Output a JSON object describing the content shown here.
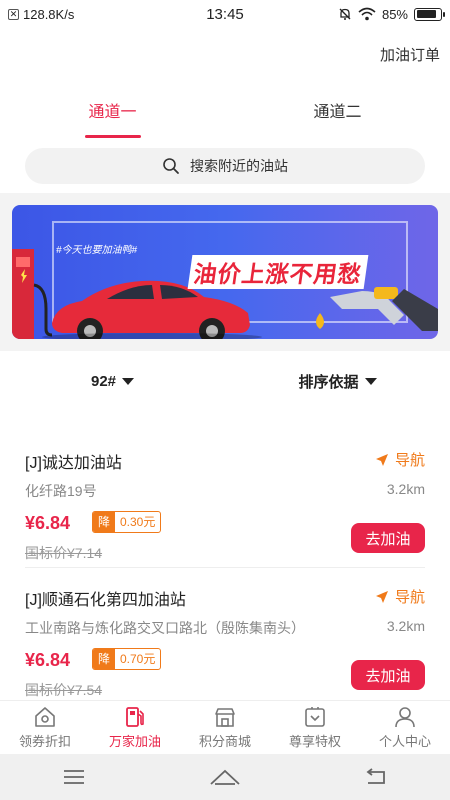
{
  "status": {
    "speed": "128.8K/s",
    "time": "13:45",
    "battery": "85%",
    "battery_level": 0.85
  },
  "header": {
    "order_link": "加油订单"
  },
  "tabs": [
    {
      "label": "通道一",
      "active": true
    },
    {
      "label": "通道二",
      "active": false
    }
  ],
  "search": {
    "placeholder": "搜索附近的油站"
  },
  "banner": {
    "tag": "#今天也要加油鸭#",
    "title": "油价上涨不用愁"
  },
  "filters": {
    "fuel": "92#",
    "sort": "排序依据"
  },
  "stations": [
    {
      "name": "[J]诚达加油站",
      "nav": "导航",
      "address": "化纤路19号",
      "distance": "3.2km",
      "price": "¥6.84",
      "discount_label": "降",
      "discount": "0.30元",
      "standard_price": "国标价¥7.14",
      "button": "去加油"
    },
    {
      "name": "[J]顺通石化第四加油站",
      "nav": "导航",
      "address": "工业南路与炼化路交叉口路北（殷陈集南头）",
      "distance": "3.2km",
      "price": "¥6.84",
      "discount_label": "降",
      "discount": "0.70元",
      "standard_price": "国标价¥7.54",
      "button": "去加油"
    }
  ],
  "tabbar": [
    {
      "label": "领券折扣",
      "icon": "home-coupon-icon",
      "active": false
    },
    {
      "label": "万家加油",
      "icon": "fuel-pump-icon",
      "active": true
    },
    {
      "label": "积分商城",
      "icon": "store-icon",
      "active": false
    },
    {
      "label": "尊享特权",
      "icon": "privilege-icon",
      "active": false
    },
    {
      "label": "个人中心",
      "icon": "user-icon",
      "active": false
    }
  ],
  "colors": {
    "accent": "#e8254a",
    "nav_orange": "#f07a1a",
    "banner_blue": "#3c56e6"
  }
}
